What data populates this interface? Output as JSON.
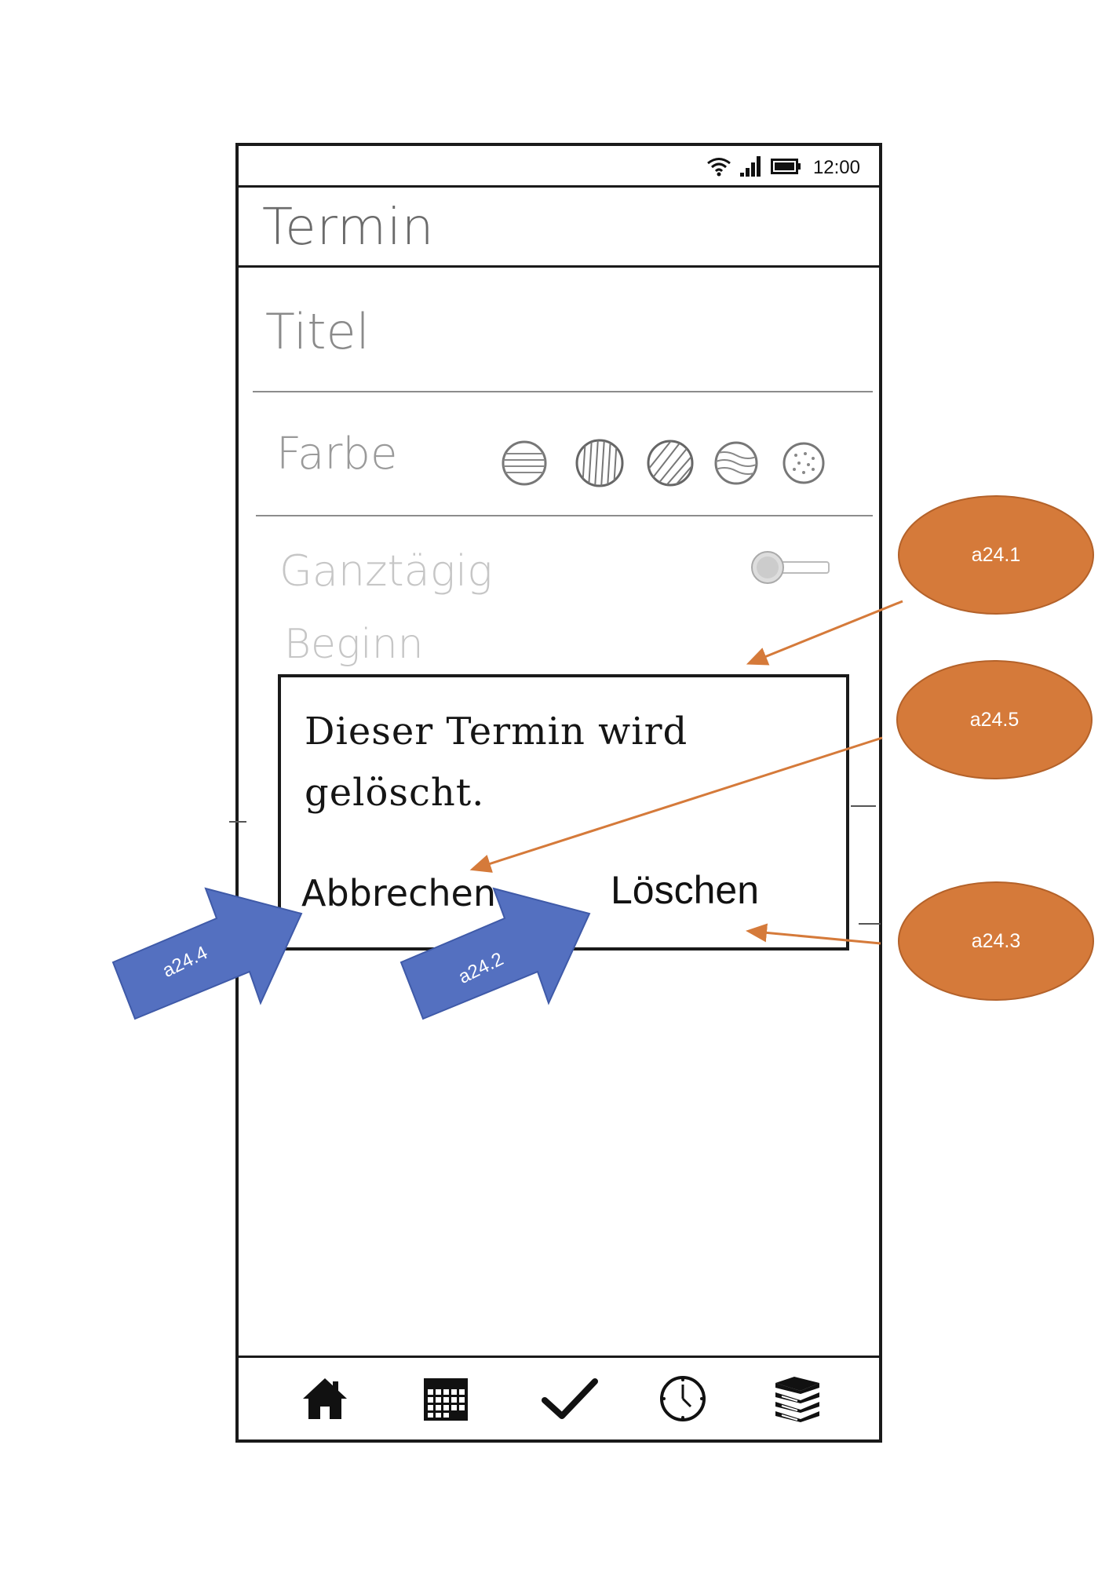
{
  "status_bar": {
    "time": "12:00",
    "icons": [
      "wifi-icon",
      "signal-icon",
      "battery-icon"
    ]
  },
  "app_bar": {
    "title": "Termin"
  },
  "form": {
    "title_label": "Titel",
    "color_label": "Farbe",
    "color_options": [
      "horizontal-stripes",
      "vertical-stripes",
      "diagonal-stripes",
      "wave-stripes",
      "dots"
    ],
    "allday_label": "Ganztägig",
    "begin_label": "Beginn"
  },
  "dialog": {
    "message_line1": "Dieser Termin wird",
    "message_line2": "gelöscht.",
    "cancel_label": "Abbrechen",
    "delete_label": "Löschen"
  },
  "nav_bar": {
    "items": [
      "home-icon",
      "calendar-icon",
      "check-icon",
      "clock-icon",
      "books-icon"
    ]
  },
  "annotations": {
    "callouts": [
      "a24.1",
      "a24.5",
      "a24.3"
    ],
    "arrows": [
      "a24.4",
      "a24.2"
    ],
    "callout_color": "#D57A3A",
    "arrow_color": "#5470C0"
  }
}
